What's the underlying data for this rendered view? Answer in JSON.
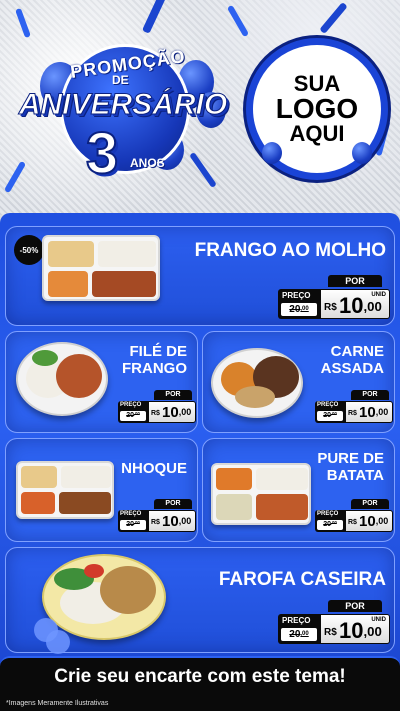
{
  "header": {
    "promo_line1": "PROMOÇÃO",
    "promo_de": "DE",
    "promo_line2": "ANIVERSÁRIO",
    "promo_number": "3",
    "promo_anos": "ANOS",
    "logo_line1": "SUA",
    "logo_line2": "LOGO",
    "logo_line3": "AQUI"
  },
  "products": [
    {
      "name": "FRANGO AO MOLHO",
      "discount": "-50%",
      "por": "POR",
      "preco_label": "PREÇO",
      "old_price": "20",
      "old_cents": ",00",
      "currency": "R$",
      "price": "10",
      "cents": ",00",
      "unid": "UNID"
    },
    {
      "name_l1": "FILÉ DE",
      "name_l2": "FRANGO",
      "por": "POR",
      "preco_label": "PREÇO",
      "old_price": "20",
      "old_cents": ",00",
      "currency": "R$",
      "price": "10",
      "cents": ",00",
      "unid": "UNID"
    },
    {
      "name_l1": "CARNE",
      "name_l2": "ASSADA",
      "por": "POR",
      "preco_label": "PREÇO",
      "old_price": "20",
      "old_cents": ",00",
      "currency": "R$",
      "price": "10",
      "cents": ",00",
      "unid": "UNID"
    },
    {
      "name": "NHOQUE",
      "por": "POR",
      "preco_label": "PREÇO",
      "old_price": "20",
      "old_cents": ",00",
      "currency": "R$",
      "price": "10",
      "cents": ",00",
      "unid": "UNID"
    },
    {
      "name_l1": "PURE DE",
      "name_l2": "BATATA",
      "por": "POR",
      "preco_label": "PREÇO",
      "old_price": "20",
      "old_cents": ",00",
      "currency": "R$",
      "price": "10",
      "cents": ",00",
      "unid": "UNID"
    },
    {
      "name": "FAROFA CASEIRA",
      "por": "POR",
      "preco_label": "PREÇO",
      "old_price": "20",
      "old_cents": ",00",
      "currency": "R$",
      "price": "10",
      "cents": ",00",
      "unid": "UNID"
    }
  ],
  "footer": {
    "cta": "Crie seu encarte com este tema!",
    "note": "*Imagens Meramente Ilustrativas"
  },
  "colors": {
    "primary_blue": "#2d62f0",
    "dark": "#0a0a0a",
    "white": "#ffffff"
  }
}
